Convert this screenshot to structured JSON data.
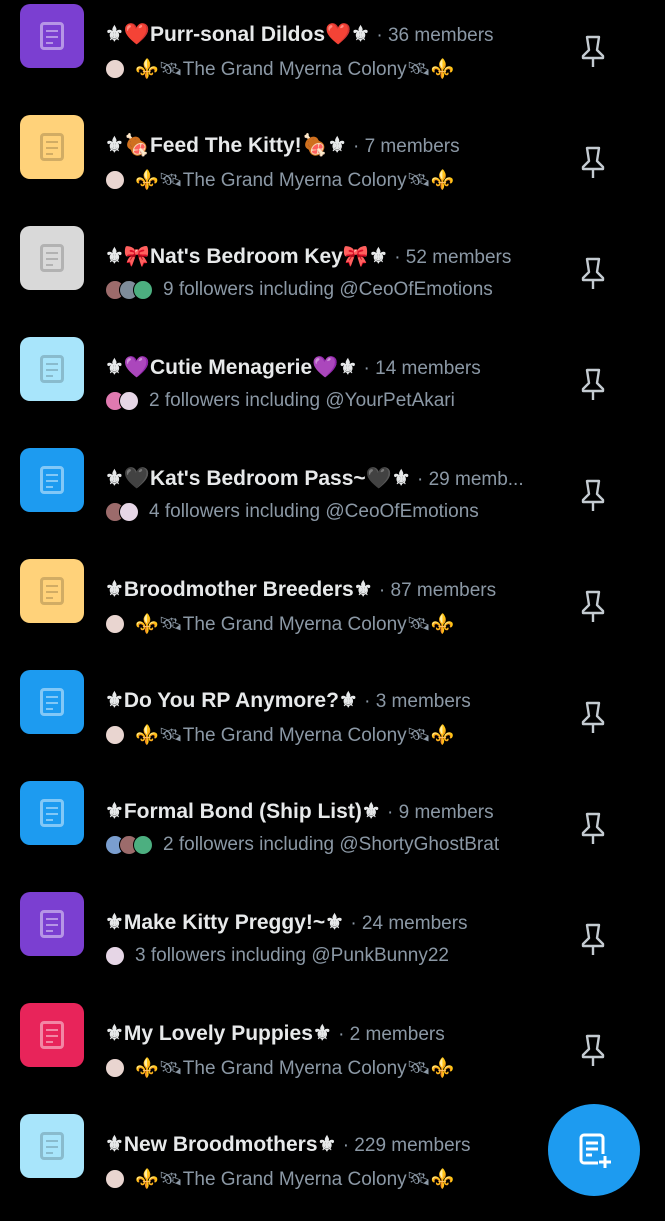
{
  "colors": {
    "accent": "#1d9bf0",
    "background": "#000000",
    "muted": "#8b98a5"
  },
  "lists": [
    {
      "name": "⚜❤️Purr-sonal Dildos❤️⚜",
      "members": "· 36 members",
      "sub": "⚜️🛰The Grand Myerna Colony🛰⚜️",
      "color": "#7b3fd1",
      "light": false,
      "avatars": [
        "#e9d5d0"
      ]
    },
    {
      "name": "⚜🍖Feed The Kitty!🍖⚜",
      "members": "· 7 members",
      "sub": "⚜️🛰The Grand Myerna Colony🛰⚜️",
      "color": "#ffd27a",
      "light": true,
      "avatars": [
        "#e9d5d0"
      ]
    },
    {
      "name": "⚜🎀Nat's Bedroom Key🎀⚜",
      "members": "· 52 members",
      "sub": "9 followers including @CeoOfEmotions",
      "color": "#d9d9d9",
      "light": true,
      "avatars": [
        "#9c6b6b",
        "#7e8c9a",
        "#4caf80"
      ]
    },
    {
      "name": "⚜💜Cutie Menagerie💜⚜",
      "members": "· 14 members",
      "sub": "2 followers including @YourPetAkari",
      "color": "#a8e5fb",
      "light": true,
      "avatars": [
        "#e07ab0",
        "#e6d6e6"
      ]
    },
    {
      "name": "⚜🖤Kat's Bedroom Pass~🖤⚜",
      "members": "· 29 memb...",
      "sub": "4 followers including @CeoOfEmotions",
      "color": "#1d9bf0",
      "light": false,
      "avatars": [
        "#9c6b6b",
        "#e6d6e6"
      ]
    },
    {
      "name": "⚜Broodmother Breeders⚜",
      "members": "· 87 members",
      "sub": "⚜️🛰The Grand Myerna Colony🛰⚜️",
      "color": "#ffd27a",
      "light": true,
      "avatars": [
        "#e9d5d0"
      ]
    },
    {
      "name": "⚜Do You RP Anymore?⚜",
      "members": "· 3 members",
      "sub": "⚜️🛰The Grand Myerna Colony🛰⚜️",
      "color": "#1d9bf0",
      "light": false,
      "avatars": [
        "#e9d5d0"
      ]
    },
    {
      "name": "⚜Formal Bond (Ship List)⚜",
      "members": "· 9 members",
      "sub": "2 followers including @ShortyGhostBrat",
      "color": "#1d9bf0",
      "light": false,
      "avatars": [
        "#7a9ecf",
        "#9c6b6b",
        "#4caf80"
      ]
    },
    {
      "name": "⚜Make Kitty Preggy!~⚜",
      "members": "· 24 members",
      "sub": "3 followers including @PunkBunny22",
      "color": "#7b3fd1",
      "light": false,
      "avatars": [
        "#e6d6e6"
      ]
    },
    {
      "name": "⚜My Lovely Puppies⚜",
      "members": "· 2 members",
      "sub": "⚜️🛰The Grand Myerna Colony🛰⚜️",
      "color": "#e8245a",
      "light": false,
      "avatars": [
        "#e9d5d0"
      ]
    },
    {
      "name": "⚜New Broodmothers⚜",
      "members": "· 229 members",
      "sub": "⚜️🛰The Grand Myerna Colony🛰⚜️",
      "color": "#a8e5fb",
      "light": true,
      "avatars": [
        "#e9d5d0"
      ]
    }
  ],
  "fab": {
    "icon": "new-list-icon"
  }
}
